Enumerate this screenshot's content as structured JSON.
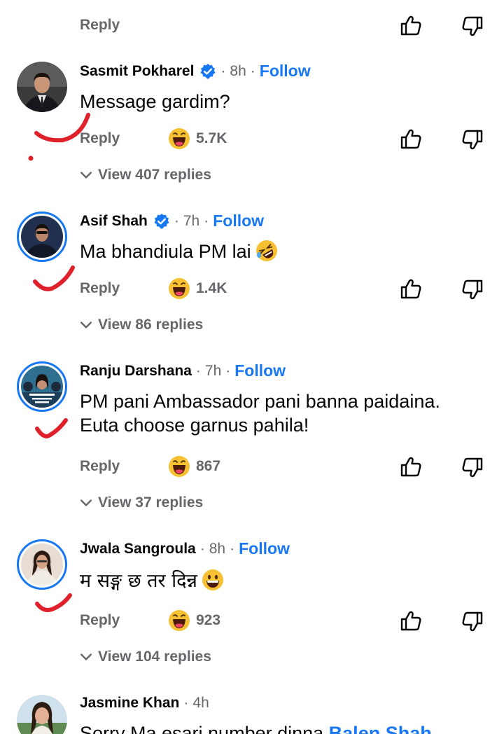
{
  "top": {
    "reply_label": "Reply"
  },
  "comments": [
    {
      "name": "Sasmit Pokharel",
      "verified": true,
      "time": "8h",
      "follow": "Follow",
      "text": "Message gardim?",
      "reply_label": "Reply",
      "reaction_count": "5.7K",
      "view_replies": "View 407 replies"
    },
    {
      "name": "Asif Shah",
      "verified": true,
      "time": "7h",
      "follow": "Follow",
      "text": "Ma bhandiula PM lai",
      "reply_label": "Reply",
      "reaction_count": "1.4K",
      "view_replies": "View 86 replies"
    },
    {
      "name": "Ranju Darshana",
      "verified": false,
      "time": "7h",
      "follow": "Follow",
      "text": "PM pani Ambassador pani banna paidaina.\nEuta choose garnus pahila!",
      "reply_label": "Reply",
      "reaction_count": "867",
      "view_replies": "View 37 replies"
    },
    {
      "name": "Jwala Sangroula",
      "verified": false,
      "time": "8h",
      "follow": "Follow",
      "text": "म सङ्ग छ तर दिन्न",
      "reply_label": "Reply",
      "reaction_count": "923",
      "view_replies": "View 104 replies"
    },
    {
      "name": "Jasmine Khan",
      "time": "4h",
      "text": "Sorry Ma esari number dinna",
      "mention": "Balen Shah"
    }
  ],
  "icons": {
    "like": "thumbs-up-icon",
    "dislike": "thumbs-down-icon",
    "verified": "verified-badge-icon",
    "reaction": "laughing-face-icon",
    "chevron": "chevron-down-icon"
  },
  "colors": {
    "link": "#1877f2",
    "muted": "#65676b",
    "text": "#050505",
    "marker": "#e0202a"
  }
}
